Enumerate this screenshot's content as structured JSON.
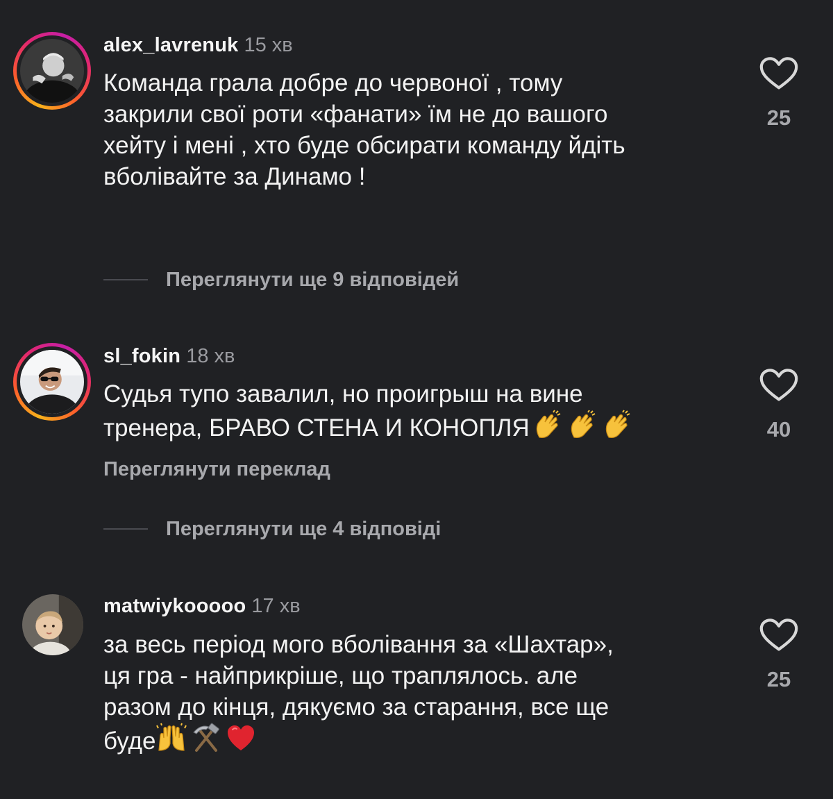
{
  "comments": [
    {
      "username": "alex_lavrenuk",
      "time": "15 хв",
      "text_lines": [
        "Команда грала добре до червоної , тому",
        "закрили свої роти «фанати» їм не до вашого",
        "хейту і мені , хто буде обсирати команду йдіть",
        "вболівайте за Динамо !"
      ],
      "likes": "25",
      "like_icon": "heart-outline-icon",
      "replies_label": "Переглянути ще 9 відповідей"
    },
    {
      "username": "sl_fokin",
      "time": "18 хв",
      "text_lines": [
        "Судья тупо завалил, но проигрыш на вине",
        "тренера, БРАВО СТЕНА И КОНОПЛЯ"
      ],
      "emojis": [
        "clapping-hands-emoji",
        "clapping-hands-emoji",
        "clapping-hands-emoji"
      ],
      "likes": "40",
      "like_icon": "heart-outline-icon",
      "translate_label": "Переглянути переклад",
      "replies_label": "Переглянути ще 4 відповіді"
    },
    {
      "username": "matwiykooooo",
      "time": "17 хв",
      "text_lines": [
        "за весь період мого вболівання за «Шахтар»,",
        "ця гра - найприкріше, що траплялось. але",
        "разом до кінця, дякуємо за старання, все ще",
        "буде"
      ],
      "emojis": [
        "raising-hands-emoji",
        "hammer-and-pick-emoji",
        "red-heart-emoji"
      ],
      "likes": "25",
      "like_icon": "heart-outline-icon"
    }
  ],
  "colors": {
    "background": "#202124",
    "text": "#f2f2f2",
    "muted": "#9a9ba0",
    "story_ring": [
      "#f7b21b",
      "#fd5c2c",
      "#e1276f",
      "#c71fa7"
    ]
  }
}
